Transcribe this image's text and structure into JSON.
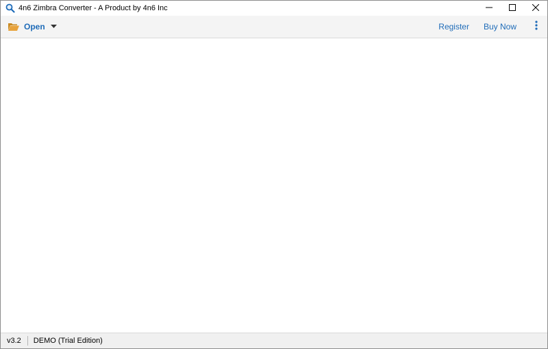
{
  "window": {
    "title": "4n6 Zimbra Converter - A Product by 4n6 Inc",
    "app_icon": "magnifier-icon",
    "controls": {
      "minimize_icon": "minimize-icon",
      "maximize_icon": "maximize-icon",
      "close_icon": "close-icon"
    }
  },
  "toolbar": {
    "open_label": "Open",
    "open_icon": "folder-open-icon",
    "open_dropdown_icon": "caret-down-icon",
    "register_label": "Register",
    "buy_now_label": "Buy Now",
    "more_icon": "vertical-ellipsis-icon"
  },
  "statusbar": {
    "version": "v3.2",
    "edition": "DEMO (Trial Edition)"
  },
  "colors": {
    "accent": "#1e6bb8",
    "toolbar_bg": "#f4f4f4",
    "statusbar_bg": "#f0f0f0",
    "folder": "#e8a33d"
  }
}
